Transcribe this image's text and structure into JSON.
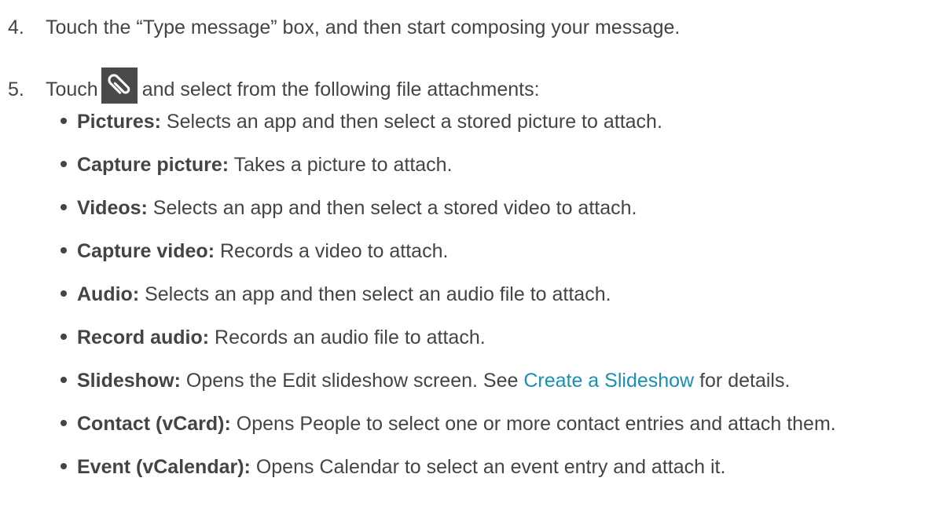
{
  "steps": {
    "four": {
      "number": "4.",
      "text": "Touch the “Type message” box, and then start composing your message."
    },
    "five": {
      "number": "5.",
      "before": "Touch",
      "icon": "paperclip-icon",
      "after": "and select from the following file attachments:"
    }
  },
  "attachments": [
    {
      "term": "Pictures:",
      "text": " Selects an app and then select a stored picture to attach."
    },
    {
      "term": "Capture picture:",
      "text": " Takes a picture to attach."
    },
    {
      "term": "Videos:",
      "text": " Selects an app and then select a stored video to attach."
    },
    {
      "term": "Capture video:",
      "text": " Records a video to attach."
    },
    {
      "term": "Audio:",
      "text": " Selects an app and then select an audio file to attach."
    },
    {
      "term": "Record audio:",
      "text": " Records an audio file to attach."
    },
    {
      "term": "Slideshow:",
      "text": " Opens the Edit slideshow screen. See ",
      "link": "Create a Slideshow",
      "after_link": " for details."
    },
    {
      "term": "Contact (vCard):",
      "text": " Opens People to select one or more contact entries and attach them."
    },
    {
      "term": "Event (vCalendar):",
      "text": " Opens Calendar to select an event entry and attach it."
    }
  ],
  "colors": {
    "text": "#444444",
    "link": "#1a8fb4",
    "icon_bg": "#4a4a4a"
  }
}
